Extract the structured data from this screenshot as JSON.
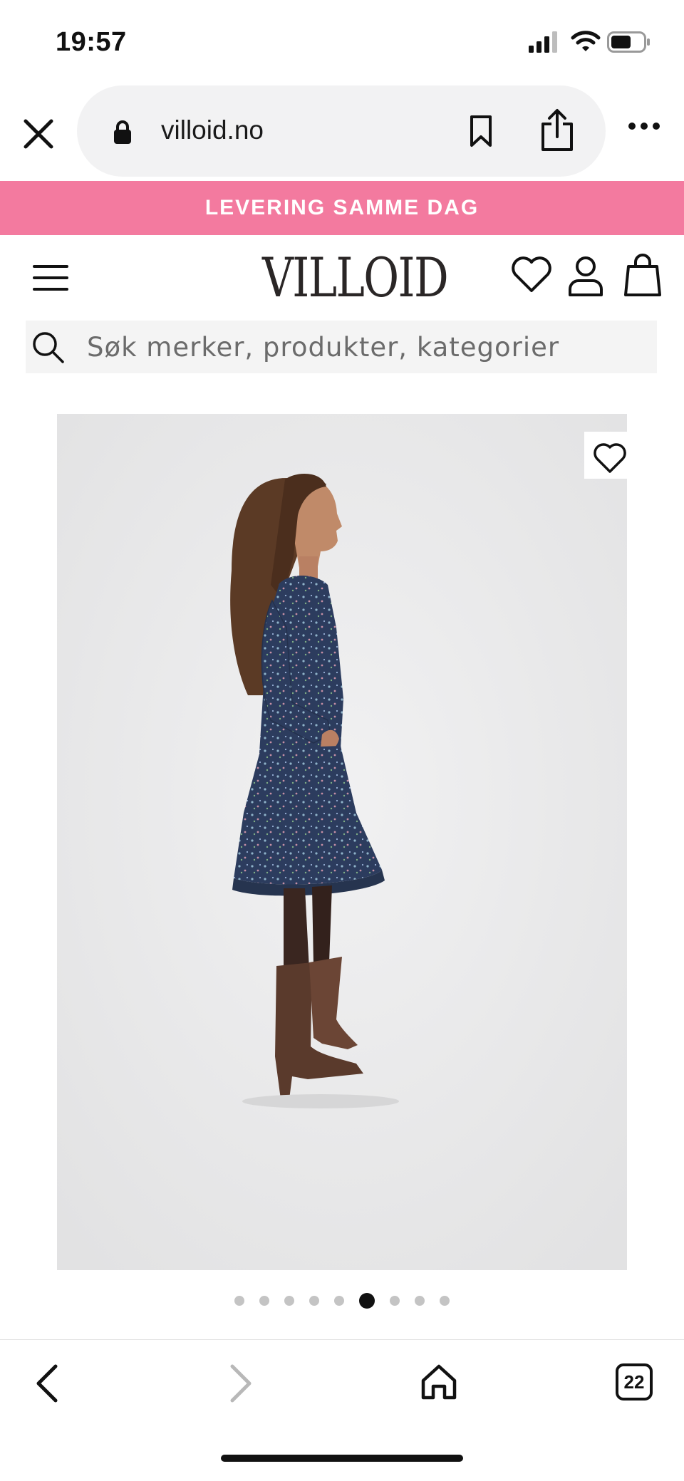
{
  "status_bar": {
    "time": "19:57"
  },
  "browser": {
    "url": "villoid.no",
    "open_tabs_count": "22"
  },
  "promo_banner": {
    "text": "LEVERING SAMME DAG"
  },
  "header": {
    "logo": "VILLOID"
  },
  "search": {
    "placeholder": "Søk merker, produkter, kategorier"
  },
  "product": {
    "image_description_icon": "photo",
    "carousel": {
      "total_images": 9,
      "active_index": 5
    }
  },
  "icons": {
    "close": "close-icon",
    "lock": "lock-icon",
    "bookmark": "bookmark-icon",
    "share": "share-icon",
    "more": "more-icon",
    "menu": "hamburger-menu-icon",
    "wishlist": "heart-icon",
    "account": "user-icon",
    "cart": "shopping-bag-icon",
    "search": "search-icon",
    "back": "chevron-left-icon",
    "forward": "chevron-right-icon",
    "home": "home-icon"
  },
  "colors": {
    "promo_bg": "#f37a9f",
    "logo": "#2a2626",
    "dress": "#2c3c5e",
    "boots": "#5a3a2c"
  }
}
